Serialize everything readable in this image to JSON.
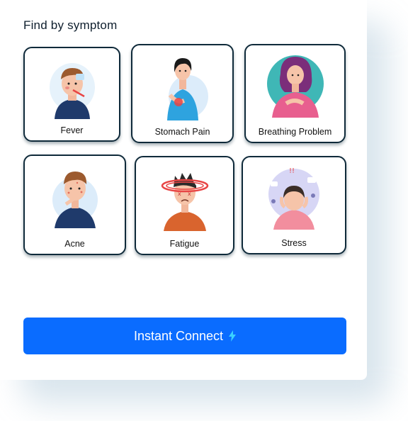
{
  "section": {
    "title": "Find by symptom"
  },
  "symptoms": [
    {
      "label": "Fever"
    },
    {
      "label": "Stomach Pain"
    },
    {
      "label": "Breathing Problem"
    },
    {
      "label": "Acne"
    },
    {
      "label": "Fatigue"
    },
    {
      "label": "Stress"
    }
  ],
  "cta": {
    "label": "Instant Connect",
    "icon": "lightning-icon"
  },
  "colors": {
    "accent": "#0a6cff",
    "card_border": "#0f2a3a",
    "bolt": "#3ad1ff"
  }
}
